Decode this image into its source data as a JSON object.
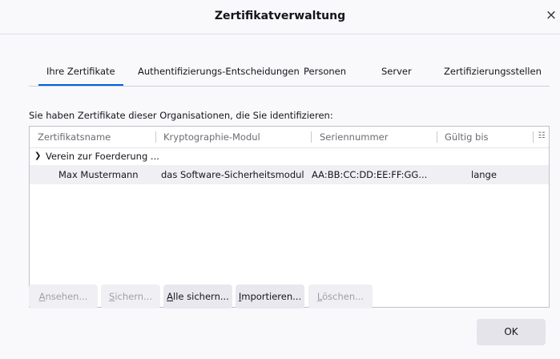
{
  "window": {
    "title": "Zertifikatverwaltung",
    "close_glyph": "×"
  },
  "tabs": [
    {
      "label": "Ihre Zertifikate",
      "active": true
    },
    {
      "label": "Authentifizierungs-Entscheidungen",
      "active": false
    },
    {
      "label": "Personen",
      "active": false
    },
    {
      "label": "Server",
      "active": false
    },
    {
      "label": "Zertifizierungsstellen",
      "active": false
    }
  ],
  "intro_text": "Sie haben Zertifikate dieser Organisationen, die Sie identifizieren:",
  "table": {
    "columns": [
      "Zertifikatsname",
      "Kryptographie-Modul",
      "Seriennummer",
      "Gültig bis"
    ],
    "column_picker_icon": "column-picker-icon",
    "group": {
      "name": "Verein zur Foerderung ...",
      "expanded": true
    },
    "rows": [
      {
        "name": "Max Mustermann",
        "module": "das Software-Sicherheitsmodul",
        "serial": "AA:BB:CC:DD:EE:FF:GG...",
        "expires": "lange"
      }
    ]
  },
  "buttons": [
    {
      "label": "Ansehen...",
      "accesskey": "A",
      "rest": "nsehen...",
      "enabled": false
    },
    {
      "label": "Sichern...",
      "accesskey": "S",
      "rest": "ichern...",
      "enabled": false
    },
    {
      "label": "Alle sichern...",
      "accesskey": "A",
      "rest": "lle sichern...",
      "enabled": true
    },
    {
      "label": "Importieren...",
      "accesskey": "I",
      "rest": "mportieren...",
      "enabled": true
    },
    {
      "label": "Löschen...",
      "accesskey": "L",
      "rest": "öschen...",
      "enabled": false
    }
  ],
  "ok_label": "OK",
  "colors": {
    "accent": "#0061e0",
    "selected_row": "#f0f0f4",
    "disabled_text": "#9e9ea6"
  }
}
